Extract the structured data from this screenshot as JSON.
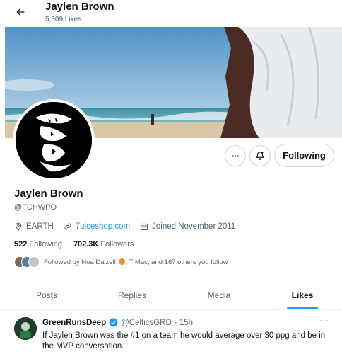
{
  "header": {
    "title": "Jaylen Brown",
    "subtitle": "5,309 Likes"
  },
  "profile": {
    "name": "Jaylen Brown",
    "handle": "@FCHWPO",
    "location": "EARTH",
    "website": "7uiceshop.com",
    "joined": "Joined November 2011",
    "following_count": "522",
    "following_label": "Following",
    "followers_count": "702.3K",
    "followers_label": "Followers",
    "followed_by_prefix": "Followed by Noa Dalzell",
    "followed_by_suffix": ", T Mac, and 167 others you follow"
  },
  "actions": {
    "more_label": "···",
    "follow_label": "Following"
  },
  "tabs": [
    {
      "label": "Posts"
    },
    {
      "label": "Replies"
    },
    {
      "label": "Media"
    },
    {
      "label": "Likes",
      "active": true
    }
  ],
  "tweet": {
    "author_name": "GreenRunsDeep",
    "author_handle": "@CelticsGRD",
    "time": "· 15h",
    "more_label": "···",
    "text": "If Jaylen Brown was the #1 on a team he would average over 30 ppg and be in the MVP conversation."
  },
  "colors": {
    "accent": "#1d9bf0",
    "text": "#0f1419",
    "muted": "#536471",
    "border": "#cfd9de"
  },
  "icons": {
    "back": "arrow-left-icon",
    "notify": "bell-plus-icon",
    "location": "location-pin-icon",
    "link": "link-icon",
    "calendar": "calendar-icon",
    "verified": "verified-badge-icon"
  }
}
